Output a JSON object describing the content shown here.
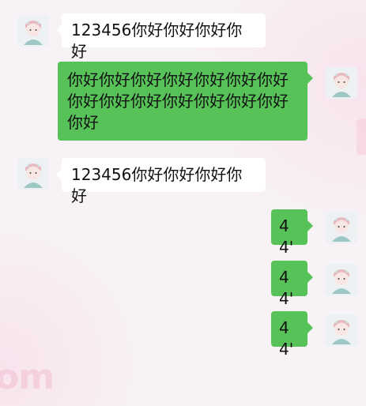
{
  "messages": [
    {
      "direction": "in",
      "text": "123456你好你好你好你好",
      "avatar_icon": "girl-avatar-icon"
    },
    {
      "direction": "out",
      "text": "你好你好你好你好你好你好你好你好你好你好你好你好你好你好你好",
      "avatar_icon": "girl-avatar-icon"
    },
    {
      "direction": "in",
      "text": "123456你好你好你好你好",
      "avatar_icon": "girl-avatar-icon"
    },
    {
      "direction": "out",
      "text": "44'",
      "avatar_icon": "girl-avatar-icon"
    },
    {
      "direction": "out",
      "text": "44'",
      "avatar_icon": "girl-avatar-icon"
    },
    {
      "direction": "out",
      "text": "44'",
      "avatar_icon": "girl-avatar-icon"
    }
  ],
  "colors": {
    "outgoing_bubble": "#56c257",
    "incoming_bubble": "#ffffff",
    "background": "#f7f2f5"
  }
}
